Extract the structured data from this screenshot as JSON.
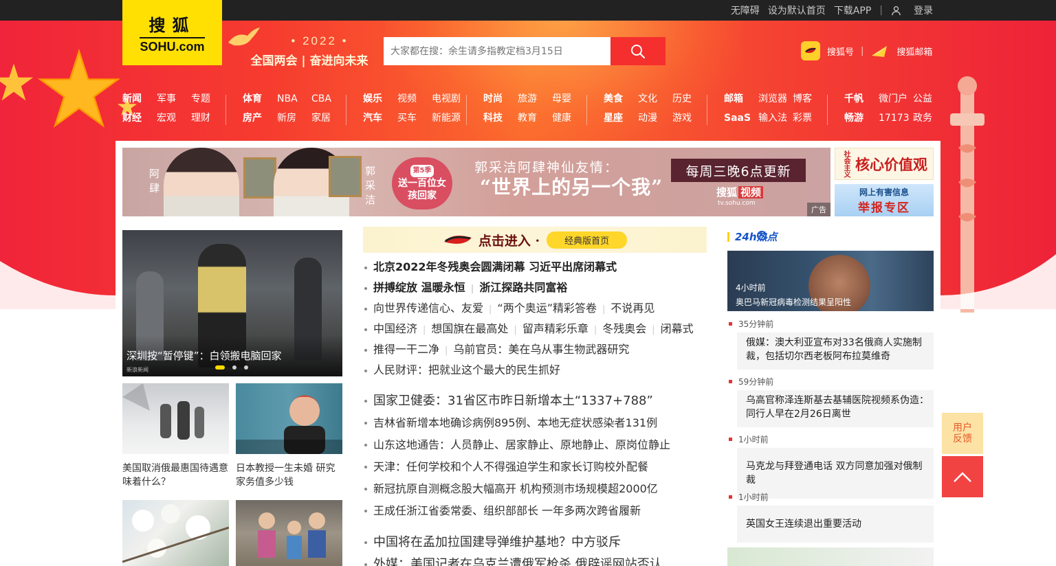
{
  "topbar": {
    "accessibility": "无障碍",
    "set_home": "设为默认首页",
    "download_app": "下载APP",
    "login": "登录"
  },
  "logo": {
    "cn": "搜狐",
    "en": "SOHU.com"
  },
  "slogan": {
    "year": "• 2022 •",
    "text": "全国两会 | 奋进向未来"
  },
  "search": {
    "placeholder": "大家都在搜：余生请多指教定档3月15日",
    "icon": "search-icon"
  },
  "quick_links": [
    {
      "label": "搜狐号",
      "icon": "sohu-hao-icon"
    },
    {
      "label": "搜狐邮箱",
      "icon": "mail-icon"
    }
  ],
  "nav": [
    {
      "row1": [
        "新闻",
        "军事",
        "专题"
      ],
      "row2": [
        "财经",
        "宏观",
        "理财"
      ]
    },
    {
      "row1": [
        "体育",
        "NBA",
        "CBA"
      ],
      "row2": [
        "房产",
        "新房",
        "家居"
      ]
    },
    {
      "row1": [
        "娱乐",
        "视频",
        "电视剧"
      ],
      "row2": [
        "汽车",
        "买车",
        "新能源"
      ]
    },
    {
      "row1": [
        "时尚",
        "旅游",
        "母婴"
      ],
      "row2": [
        "科技",
        "教育",
        "健康"
      ]
    },
    {
      "row1": [
        "美食",
        "文化",
        "历史"
      ],
      "row2": [
        "星座",
        "动漫",
        "游戏"
      ]
    },
    {
      "row1": [
        "邮箱",
        "浏览器",
        "博客"
      ],
      "row2": [
        "SaaS",
        "输入法",
        "彩票"
      ]
    },
    {
      "row1": [
        "千帆",
        "微门户",
        "公益"
      ],
      "row2": [
        "畅游",
        "17173",
        "政务"
      ]
    }
  ],
  "banner": {
    "name_left": "阿肆",
    "name_right": "郭采洁",
    "badge_top": "第5季",
    "badge_main": "送一百位女孩回家",
    "headline": "郭采洁阿肆神仙友情：",
    "quote": "“世界上的另一个我”",
    "schedule": "每周三晚6点更新",
    "brand": "搜狐",
    "brand_tag": "视频",
    "url": "tv.sohu.com",
    "ad_label": "广告"
  },
  "side_ads": {
    "core_small": "社会主义",
    "core": "核心价值观",
    "report_top": "网上有害信息",
    "report_main": "举报专区"
  },
  "focus": {
    "caption": "深圳按“暂停键”：白领搬电脑回家",
    "source": "新浪新闻",
    "active_slide": 1,
    "slides": 3
  },
  "thumbs": [
    {
      "caption": "美国取消俄最惠国待遇意味着什么？"
    },
    {
      "caption": "日本教授一生未婚 研究家务值多少钱"
    }
  ],
  "classic": {
    "label": "点击进入 ·",
    "button": "经典版首页"
  },
  "news_top": [
    {
      "items": [
        "北京2022年冬残奥会圆满闭幕 习近平出席闭幕式"
      ],
      "head": true
    },
    {
      "items": [
        "拼搏绽放 温暖永恒",
        "浙江探路共同富裕"
      ],
      "head": true
    },
    {
      "items": [
        "向世界传递信心、友爱",
        "“两个奥运”精彩答卷",
        "不说再见"
      ]
    },
    {
      "items": [
        "中国经济",
        "想国旗在最高处",
        "留声精彩乐章",
        "冬残奥会",
        "闭幕式"
      ]
    },
    {
      "items": [
        "推得一干二净",
        "乌前官员：美在乌从事生物武器研究"
      ]
    },
    {
      "items": [
        "人民财评：把就业这个最大的民生抓好"
      ]
    }
  ],
  "news_mid": [
    "国家卫健委：31省区市昨日新增本土“1337+788”",
    "吉林省新增本地确诊病例895例、本地无症状感染者131例",
    "山东这地通告：人员静止、居家静止、原地静止、原岗位静止",
    "天津：任何学校和个人不得强迫学生和家长订购校外配餐",
    "新冠抗原自测概念股大幅高开 机构预测市场规模超2000亿",
    "王成任浙江省委常委、组织部部长 一年多两次跨省履新"
  ],
  "news_bottom": [
    "中国将在孟加拉国建导弹维护基地？中方驳斥",
    "外媒：美国记者在乌克兰遭俄军枪杀 俄辟谣网站否认"
  ],
  "hot": {
    "title": "24h热点",
    "top": {
      "time": "4小时前",
      "text": "奥巴马新冠病毒检测结果呈阳性"
    },
    "items": [
      {
        "time": "35分钟前",
        "text": "俄媒：澳大利亚宣布对33名俄商人实施制裁，包括切尔西老板阿布拉莫维奇"
      },
      {
        "time": "59分钟前",
        "text": "乌高官称泽连斯基去基辅医院视频系伪造：同行人早在2月26日离世"
      },
      {
        "time": "1小时前",
        "text": "马克龙与拜登通电话 双方同意加强对俄制裁"
      },
      {
        "time": "1小时前",
        "text": "英国女王连续退出重要活动"
      }
    ]
  },
  "float": {
    "feedback_1": "用户",
    "feedback_2": "反馈"
  },
  "colors": {
    "brand_yellow": "#ffe002",
    "festive_red": "#f0243a",
    "search_red": "#f52e2e",
    "totop_red": "#f24343"
  }
}
